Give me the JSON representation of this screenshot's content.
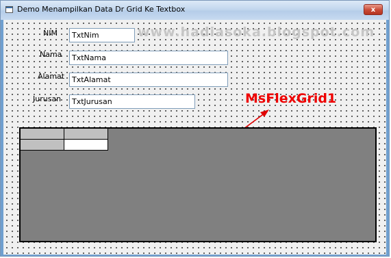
{
  "window": {
    "title": "Demo Menampilkan Data Dr Grid Ke Textbox",
    "close_label": "x"
  },
  "form": {
    "fields": [
      {
        "label": "NIM",
        "value": "TxtNim"
      },
      {
        "label": "Nama",
        "value": "TxtNama"
      },
      {
        "label": "Alamat",
        "value": "TxtAlamat"
      },
      {
        "label": "Jurusan",
        "value": "TxtJurusan"
      }
    ],
    "watermark": "www.hadiasoka.blogspot.com",
    "annotation": "MsFlexGrid1"
  },
  "colors": {
    "annotation": "#ee0000",
    "grid_background": "#808080",
    "form_background": "#f0f0f0"
  }
}
